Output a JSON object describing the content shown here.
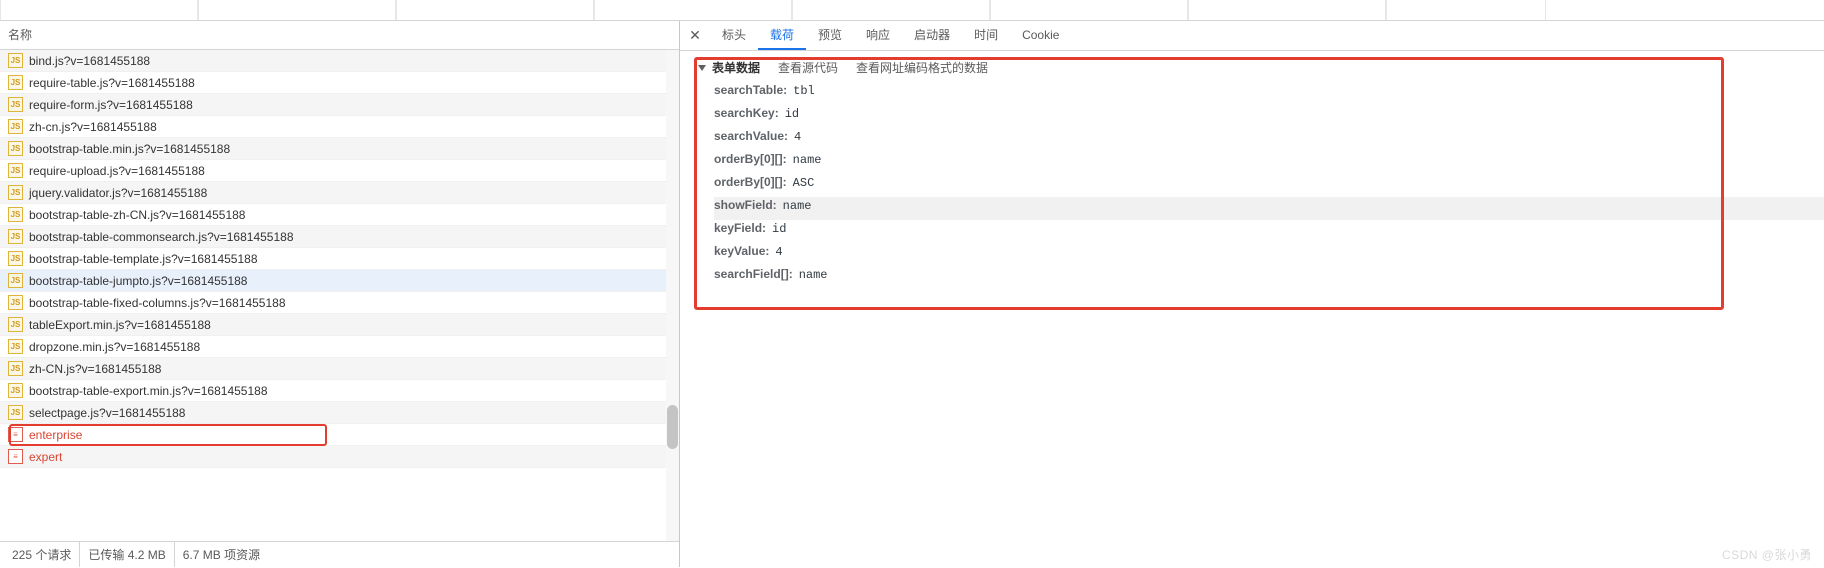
{
  "left": {
    "headerLabel": "名称",
    "requests": [
      {
        "icon": "js",
        "name": "bind.js?v=1681455188",
        "xhr": false
      },
      {
        "icon": "js",
        "name": "require-table.js?v=1681455188",
        "xhr": false
      },
      {
        "icon": "js",
        "name": "require-form.js?v=1681455188",
        "xhr": false
      },
      {
        "icon": "js",
        "name": "zh-cn.js?v=1681455188",
        "xhr": false
      },
      {
        "icon": "js",
        "name": "bootstrap-table.min.js?v=1681455188",
        "xhr": false
      },
      {
        "icon": "js",
        "name": "require-upload.js?v=1681455188",
        "xhr": false
      },
      {
        "icon": "js",
        "name": "jquery.validator.js?v=1681455188",
        "xhr": false
      },
      {
        "icon": "js",
        "name": "bootstrap-table-zh-CN.js?v=1681455188",
        "xhr": false
      },
      {
        "icon": "js",
        "name": "bootstrap-table-commonsearch.js?v=1681455188",
        "xhr": false
      },
      {
        "icon": "js",
        "name": "bootstrap-table-template.js?v=1681455188",
        "xhr": false
      },
      {
        "icon": "js",
        "name": "bootstrap-table-jumpto.js?v=1681455188",
        "xhr": false,
        "selected": true
      },
      {
        "icon": "js",
        "name": "bootstrap-table-fixed-columns.js?v=1681455188",
        "xhr": false
      },
      {
        "icon": "js",
        "name": "tableExport.min.js?v=1681455188",
        "xhr": false
      },
      {
        "icon": "js",
        "name": "dropzone.min.js?v=1681455188",
        "xhr": false
      },
      {
        "icon": "js",
        "name": "zh-CN.js?v=1681455188",
        "xhr": false
      },
      {
        "icon": "js",
        "name": "bootstrap-table-export.min.js?v=1681455188",
        "xhr": false
      },
      {
        "icon": "js",
        "name": "selectpage.js?v=1681455188",
        "xhr": false
      },
      {
        "icon": "doc",
        "name": "enterprise",
        "xhr": true
      },
      {
        "icon": "doc",
        "name": "expert",
        "xhr": true
      }
    ],
    "status": {
      "requests": "225 个请求",
      "transferred": "已传输 4.2 MB",
      "resources": "6.7 MB 项资源"
    }
  },
  "right": {
    "tabs": {
      "headers": "标头",
      "payload": "载荷",
      "preview": "预览",
      "response": "响应",
      "initiator": "启动器",
      "timing": "时间",
      "cookies": "Cookie"
    },
    "payload": {
      "sectionTitle": "表单数据",
      "viewSource": "查看源代码",
      "viewUrlEncoded": "查看网址编码格式的数据",
      "params": [
        {
          "k": "searchTable:",
          "v": "tbl"
        },
        {
          "k": "searchKey:",
          "v": "id"
        },
        {
          "k": "searchValue:",
          "v": "4"
        },
        {
          "k": "orderBy[0][]:",
          "v": "name"
        },
        {
          "k": "orderBy[0][]:",
          "v": "ASC"
        },
        {
          "k": "showField:",
          "v": "name",
          "hl": true
        },
        {
          "k": "keyField:",
          "v": "id"
        },
        {
          "k": "keyValue:",
          "v": "4"
        },
        {
          "k": "searchField[]:",
          "v": "name"
        }
      ]
    }
  },
  "watermark": "CSDN @张小勇"
}
